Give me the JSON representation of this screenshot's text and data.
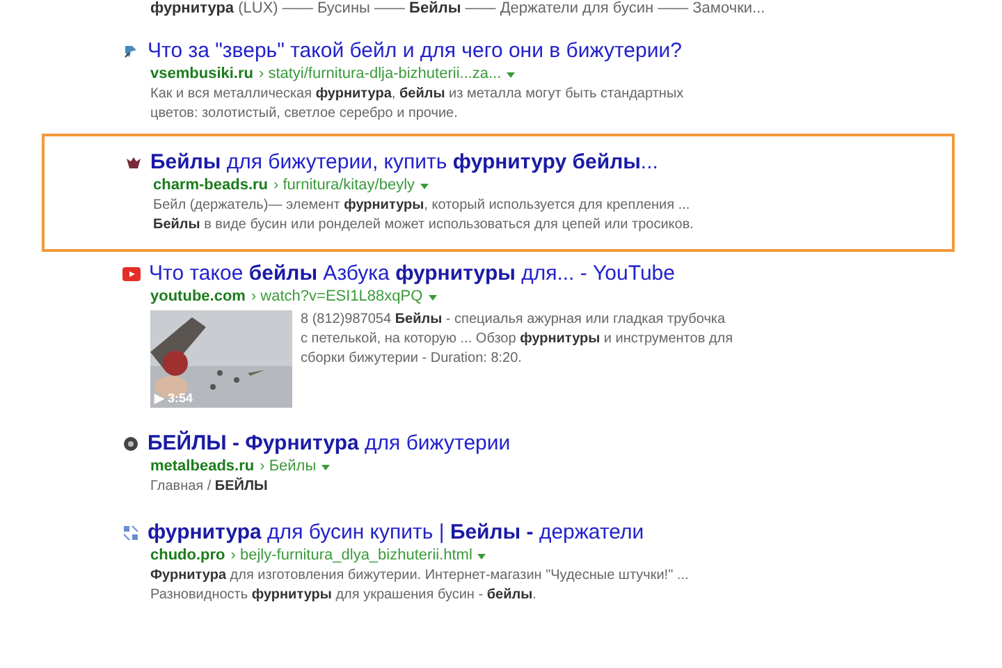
{
  "top_snippet": "**фурнитура** (LUX) —— Бусины —— **Бейлы** —— Держатели для бусин —— Замочки...",
  "results": [
    {
      "highlighted": false,
      "title": "Что за \"зверь\" такой бейл и для чего они в бижутерии?",
      "domain": "vsembusiki.ru",
      "path": "› statyi/furnitura-dlja-bizhuterii...za...",
      "snippet": [
        "Как и вся металлическая **фурнитура**, **бейлы** из металла могут быть стандартных",
        "цветов: золотистый, светлое серебро и прочие."
      ]
    },
    {
      "highlighted": true,
      "title": "**Бейлы** для бижутерии, купить **фурнитуру бейлы**...",
      "domain": "charm-beads.ru",
      "path": "› furnitura/kitay/beyly",
      "snippet": [
        "Бейл (держатель)— элемент **фурнитуры**, который используется для крепления ...",
        "**Бейлы** в виде бусин или ронделей может использоваться для цепей или тросиков."
      ]
    },
    {
      "highlighted": false,
      "title": "Что такое **бейлы** Азбука **фурнитуры** для... - YouTube",
      "domain": "youtube.com",
      "path": "› watch?v=ESI1L88xqPQ",
      "thumbnail": {
        "kind": "picture",
        "duration": "▶ 3:54"
      },
      "snippet": [
        "8 (812)987054 **Бейлы** - специалья ажурная или гладкая трубочка",
        "с петелькой, на которую ... Обзор **фурнитуры** и инструментов для",
        "сборки бижутерии - Duration: 8:20."
      ]
    },
    {
      "highlighted": false,
      "title": "**БЕЙЛЫ - Фурнитура** для бижутерии",
      "domain": "metalbeads.ru",
      "path": "› Бейлы",
      "snippet": [
        "Главная / **БЕЙЛЫ**"
      ]
    },
    {
      "highlighted": false,
      "title": "**фурнитура** для бусин купить | **Бейлы -** держатели",
      "domain": "chudo.pro",
      "path": "› bejly-furnitura_dlya_bizhuterii.html",
      "snippet": [
        "**Фурнитура** для изготовления бижутерии. Интернет-магазин \"Чудесные штучки!\" ...",
        "Разновидность **фурнитуры** для украшения бусин - **бейлы**."
      ]
    }
  ]
}
